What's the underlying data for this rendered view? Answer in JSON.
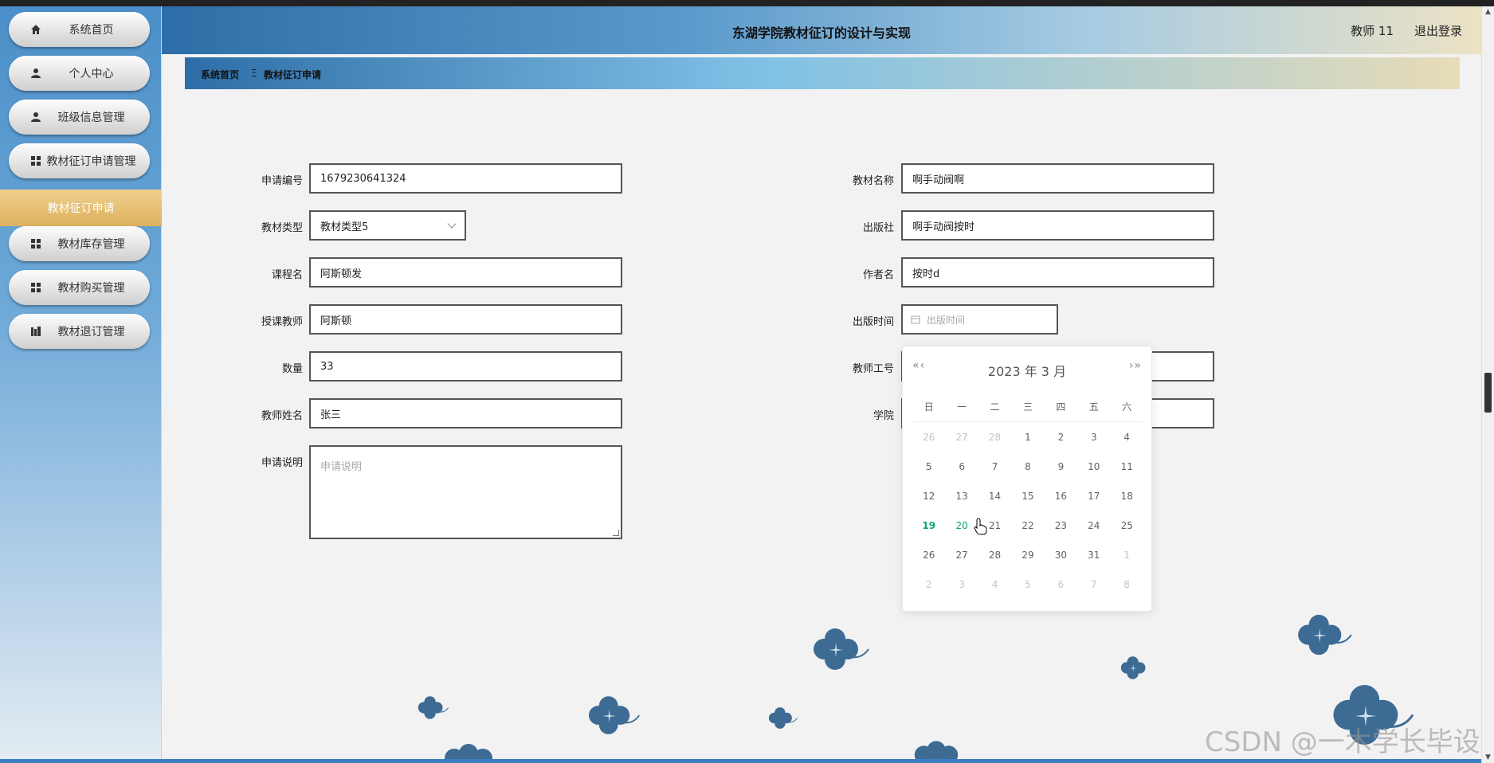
{
  "app": {
    "title": "东湖学院教材征订的设计与实现",
    "user": "教师 11",
    "logout": "退出登录"
  },
  "sidebar": {
    "items": [
      {
        "label": "系统首页",
        "icon": "home-icon"
      },
      {
        "label": "个人中心",
        "icon": "user-icon"
      },
      {
        "label": "班级信息管理",
        "icon": "user-icon"
      },
      {
        "label": "教材征订申请管理",
        "icon": "grid-icon"
      },
      {
        "label": "教材库存管理",
        "icon": "grid-icon"
      },
      {
        "label": "教材购买管理",
        "icon": "grid-icon"
      },
      {
        "label": "教材退订管理",
        "icon": "chart-icon"
      }
    ],
    "submenu": "教材征订申请"
  },
  "breadcrumb": {
    "home": "系统首页",
    "sep": "Ξ",
    "current": "教材征订申请"
  },
  "form": {
    "apply_no": {
      "label": "申请编号",
      "value": "1679230641324"
    },
    "type": {
      "label": "教材类型",
      "value": "教材类型5"
    },
    "course": {
      "label": "课程名",
      "value": "阿斯顿发"
    },
    "teacher": {
      "label": "授课教师",
      "value": "阿斯顿"
    },
    "qty": {
      "label": "数量",
      "value": "33"
    },
    "tname": {
      "label": "教师姓名",
      "value": "张三"
    },
    "desc": {
      "label": "申请说明",
      "placeholder": "申请说明"
    },
    "book": {
      "label": "教材名称",
      "value": "啊手动阀啊"
    },
    "publisher": {
      "label": "出版社",
      "value": "啊手动阀按时"
    },
    "author": {
      "label": "作者名",
      "value": "按时d"
    },
    "pubdate": {
      "label": "出版时间",
      "placeholder": "出版时间"
    },
    "tno": {
      "label": "教师工号",
      "value": ""
    },
    "college": {
      "label": "学院",
      "value": ""
    }
  },
  "datepicker": {
    "year_month": "2023 年  3 月",
    "prev": "«‹",
    "next": "›»",
    "weekdays": [
      "日",
      "一",
      "二",
      "三",
      "四",
      "五",
      "六"
    ],
    "weeks": [
      [
        "26",
        "27",
        "28",
        "1",
        "2",
        "3",
        "4"
      ],
      [
        "5",
        "6",
        "7",
        "8",
        "9",
        "10",
        "11"
      ],
      [
        "12",
        "13",
        "14",
        "15",
        "16",
        "17",
        "18"
      ],
      [
        "19",
        "20",
        "21",
        "22",
        "23",
        "24",
        "25"
      ],
      [
        "26",
        "27",
        "28",
        "29",
        "30",
        "31",
        "1"
      ],
      [
        "2",
        "3",
        "4",
        "5",
        "6",
        "7",
        "8"
      ]
    ],
    "today": "19",
    "hover": "20"
  },
  "watermark": "CSDN @一木学长毕设",
  "colors": {
    "accent": "#09a37a",
    "submenu": "#ddb05e",
    "sidebar": "#4a8fc8"
  }
}
